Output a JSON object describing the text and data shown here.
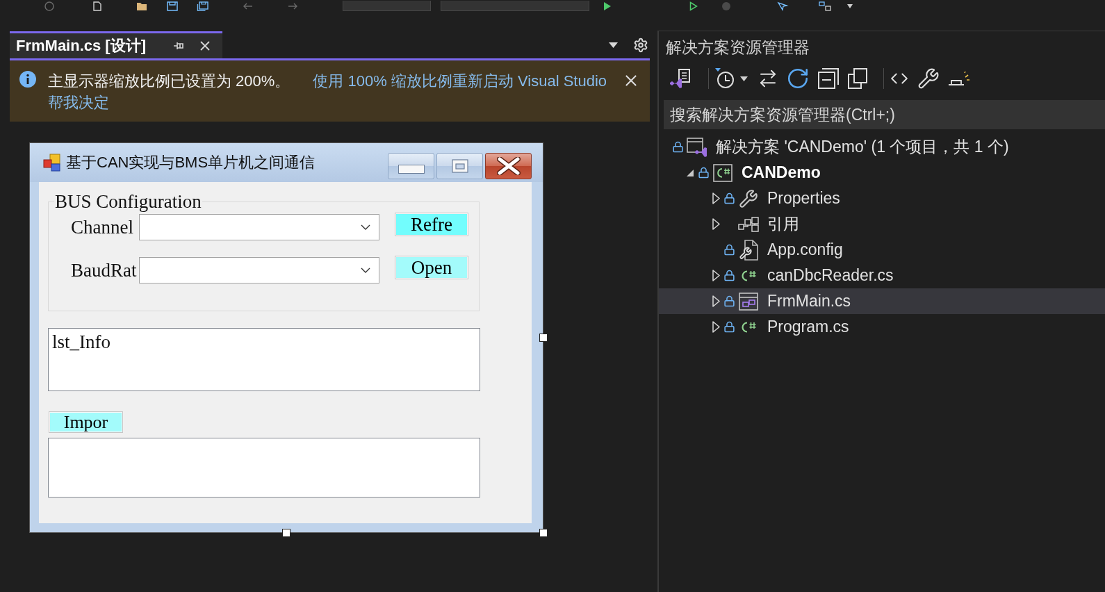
{
  "document_tab": {
    "title": "FrmMain.cs [设计]",
    "selected": true
  },
  "info_bar": {
    "message": "主显示器缩放比例已设置为 200%。",
    "links": [
      "使用 100% 缩放比例重新启动 Visual Studio",
      "帮我决定"
    ]
  },
  "designer_form": {
    "title": "基于CAN实现与BMS单片机之间通信",
    "group": {
      "title": "BUS Configuration",
      "rows": [
        {
          "label": "Channel",
          "button": {
            "label": "Refre",
            "color": "#72fdfd"
          }
        },
        {
          "label": "BaudRat",
          "button": {
            "label": "Open",
            "color": "#a3fbfb"
          }
        }
      ]
    },
    "list_box": {
      "items": [
        "lst_Info"
      ]
    },
    "import_button": {
      "label": "Impor",
      "color": "#a3fbfb"
    }
  },
  "solution_explorer": {
    "title": "解决方案资源管理器",
    "search": {
      "placeholder": "搜索解决方案资源管理器(Ctrl+;)"
    },
    "tree": [
      {
        "label": "解决方案 'CANDemo' (1 个项目，共 1 个)",
        "kind": "solution",
        "locked": true,
        "expandable": false,
        "selected": false,
        "children": [
          {
            "label": "CANDemo",
            "kind": "project",
            "locked": true,
            "expandable": true,
            "expanded": true,
            "selected": false,
            "children": [
              {
                "label": "Properties",
                "kind": "properties",
                "locked": true,
                "expandable": true,
                "expanded": false,
                "selected": false
              },
              {
                "label": "引用",
                "kind": "references",
                "locked": false,
                "expandable": true,
                "expanded": false,
                "selected": false
              },
              {
                "label": "App.config",
                "kind": "config",
                "locked": true,
                "expandable": false,
                "selected": false
              },
              {
                "label": "canDbcReader.cs",
                "kind": "csharp",
                "locked": true,
                "expandable": true,
                "expanded": false,
                "selected": false
              },
              {
                "label": "FrmMain.cs",
                "kind": "form",
                "locked": true,
                "expandable": true,
                "expanded": false,
                "selected": true
              },
              {
                "label": "Program.cs",
                "kind": "csharp",
                "locked": true,
                "expandable": true,
                "expanded": false,
                "selected": false
              }
            ]
          }
        ]
      }
    ]
  }
}
